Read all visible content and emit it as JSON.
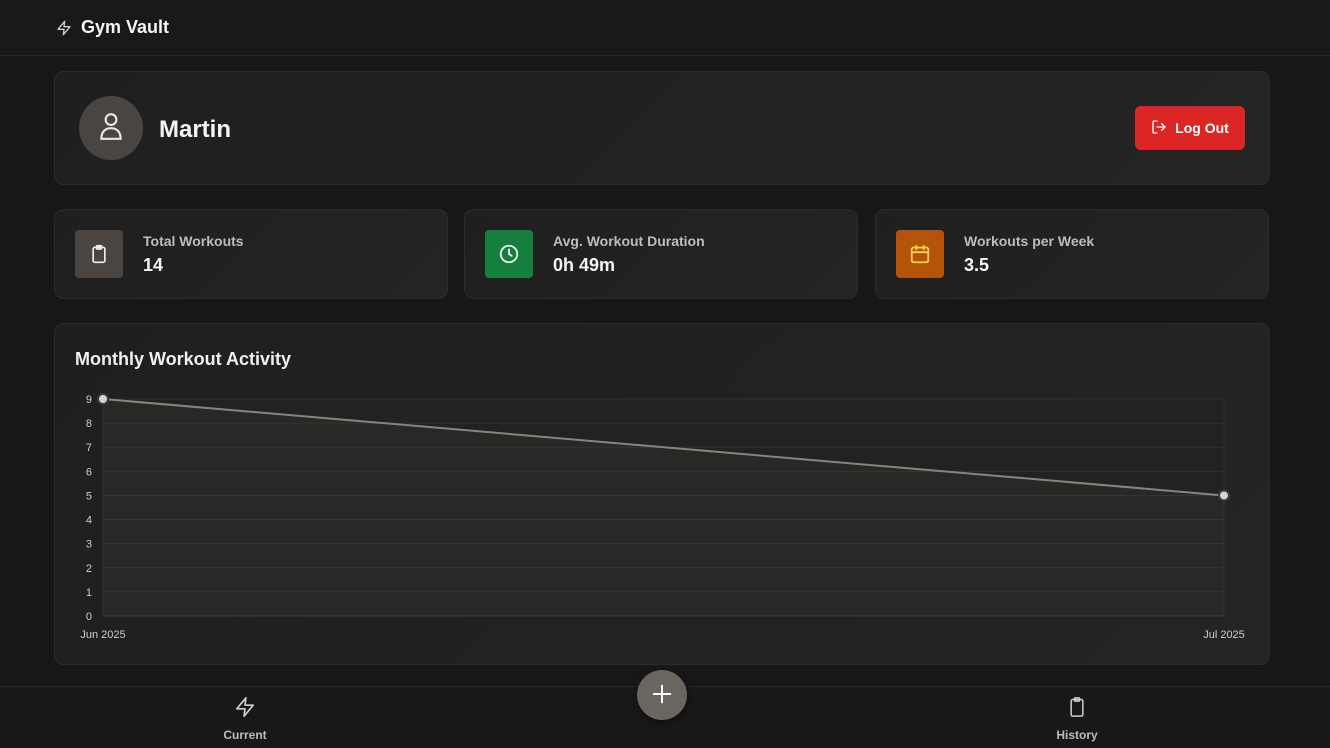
{
  "header": {
    "app_title": "Gym Vault",
    "icon": "bolt-icon"
  },
  "profile": {
    "name": "Martin",
    "avatar_icon": "user-icon",
    "logout_label": "Log Out"
  },
  "stats": [
    {
      "label": "Total Workouts",
      "value": "14",
      "icon": "clipboard-icon",
      "color": "#4a4541"
    },
    {
      "label": "Avg. Workout Duration",
      "value": "0h 49m",
      "icon": "clock-icon",
      "color": "#15803d"
    },
    {
      "label": "Workouts per Week",
      "value": "3.5",
      "icon": "calendar-icon",
      "color": "#b45309"
    }
  ],
  "chart": {
    "title": "Monthly Workout Activity"
  },
  "chart_data": {
    "type": "line",
    "title": "Monthly Workout Activity",
    "categories": [
      "Jun 2025",
      "Jul 2025"
    ],
    "values": [
      9,
      5
    ],
    "ylim": [
      0,
      9
    ],
    "yticks": [
      0,
      1,
      2,
      3,
      4,
      5,
      6,
      7,
      8,
      9
    ],
    "grid": true,
    "line_color": "#8a837d"
  },
  "nav": {
    "current_label": "Current",
    "history_label": "History",
    "add_icon": "plus-icon"
  }
}
